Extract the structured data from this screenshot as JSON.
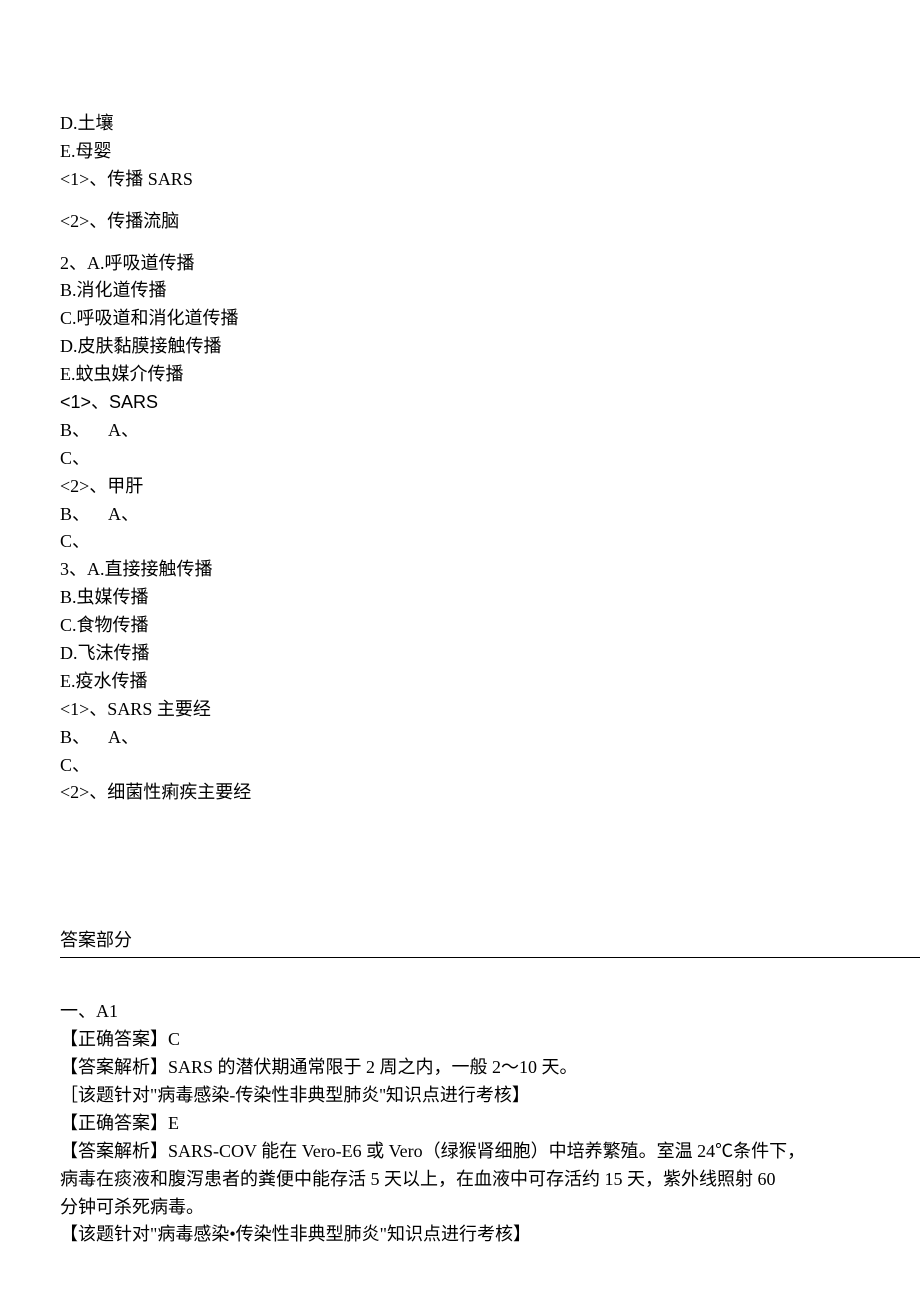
{
  "q1": {
    "optD": "D.土壤",
    "optE": "E.母婴",
    "sub1": "<1>、传播 SARS",
    "sub2": "<2>、传播流脑"
  },
  "q2": {
    "stem": "2、A.呼吸道传播",
    "optB": "B.消化道传播",
    "optC": "C.呼吸道和消化道传播",
    "optD": "D.皮肤黏膜接触传播",
    "optE": "E.蚊虫媒介传播",
    "sub1": "<1>、SARS",
    "row1": "B、    A、",
    "row2": "C、",
    "sub2": "<2>、甲肝",
    "row3": "B、    A、",
    "row4": "C、"
  },
  "q3": {
    "stem": "3、A.直接接触传播",
    "optB": "B.虫媒传播",
    "optC": "C.食物传播",
    "optD": "D.飞沫传播",
    "optE": "E.疫水传播",
    "sub1": "<1>、SARS 主要经",
    "row1": "B、    A、",
    "row2": "C、",
    "sub2": "<2>、细菌性痢疾主要经"
  },
  "answers": {
    "header": "答案部分",
    "sectionLabel": "一、A1",
    "a1": {
      "correct": "【正确答案】C",
      "explain": "【答案解析】SARS 的潜伏期通常限于 2 周之内，一般 2～10 天。",
      "note": "［该题针对\"病毒感染-传染性非典型肺炎''知识点进行考核】"
    },
    "a2": {
      "correct": "【正确答案】E",
      "explain1": "【答案解析】SARS-COV 能在 Vero-E6 或 Vero（绿猴肾细胞）中培养繁殖。室温 24℃条件下，",
      "explain2": "病毒在痰液和腹泻患者的粪便中能存活 5 天以上，在血液中可存活约 15 天，紫外线照射 60",
      "explain3": "分钟可杀死病毒。",
      "note": "【该题针对\"病毒感染•传染性非典型肺炎\"知识点进行考核】"
    }
  }
}
